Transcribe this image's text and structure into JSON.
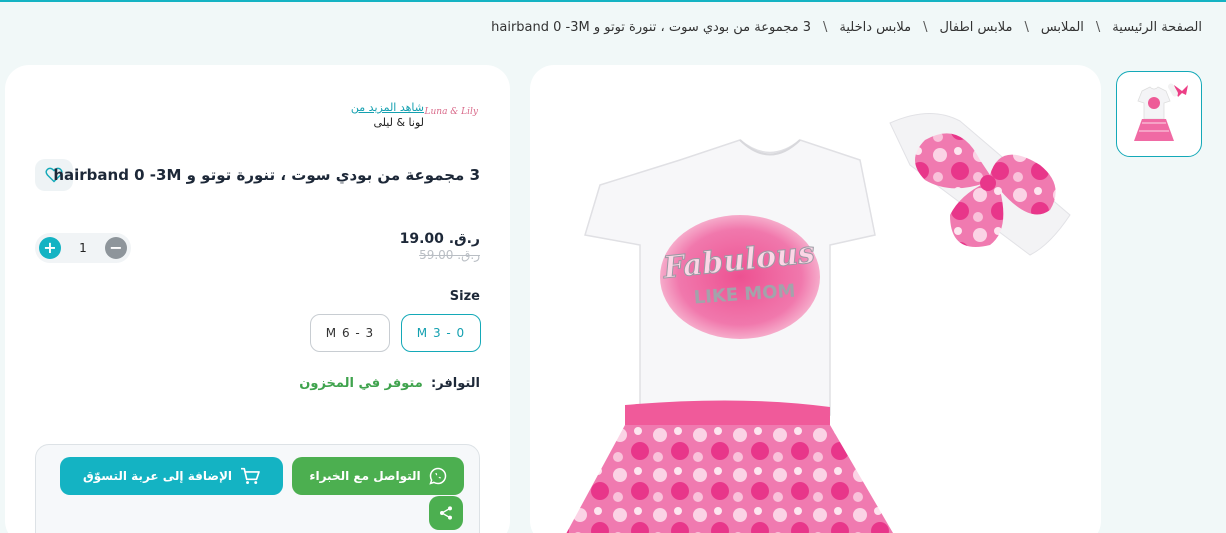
{
  "breadcrumb": [
    "الصفحة الرئيسية",
    "الملابس",
    "ملابس اطفال",
    "ملابس داخلية",
    "3 مجموعة من بودي سوت ، تنورة توتو و hairband 0 -3M"
  ],
  "brand": {
    "more_link": "شاهد المزيد من",
    "name": "لونا & ليلى",
    "logo_text": "Luna & Lily"
  },
  "product": {
    "title": "3 مجموعة من بودي سوت ، تنورة توتو و hairband 0 -3M",
    "price": "ر.ق. 19.00",
    "old_price": "ر.ق. 59.00",
    "quantity": "1",
    "size_label": "Size",
    "sizes": [
      "M 3 - 0",
      "M 6 - 3"
    ],
    "selected_size": "M 3 - 0",
    "availability_label": "التوافر:",
    "availability_value": "متوفر في المخزون",
    "print_text_1": "Fabulous",
    "print_text_2": "LIKE MOM"
  },
  "actions": {
    "contact_expert": "التواصل مع الخبراء",
    "add_to_cart": "الإضافة إلى عربة التسوّق"
  },
  "colors": {
    "accent": "#14b3c3",
    "whatsapp": "#4caf50",
    "pink": "#ec3f86"
  },
  "icons": [
    "heart-icon",
    "plus-icon",
    "minus-icon",
    "whatsapp-icon",
    "cart-icon",
    "share-icon"
  ]
}
